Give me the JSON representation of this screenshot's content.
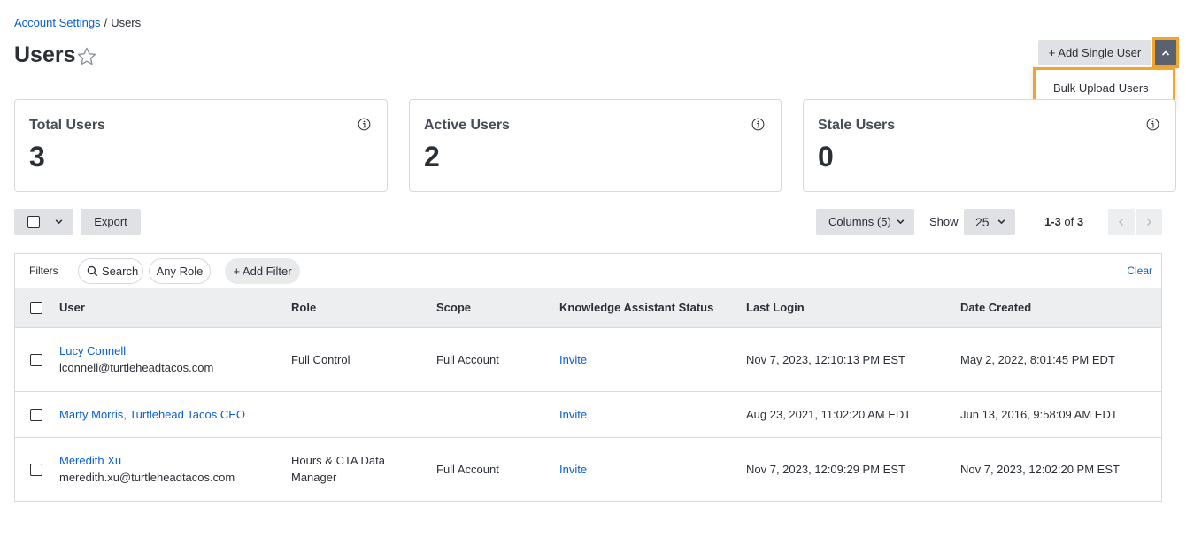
{
  "breadcrumb": {
    "parent": "Account Settings",
    "separator": "/",
    "current": "Users"
  },
  "header": {
    "title": "Users",
    "add_button": "+ Add Single User",
    "dropdown_item": "Bulk Upload Users"
  },
  "stats": [
    {
      "label": "Total Users",
      "value": "3"
    },
    {
      "label": "Active Users",
      "value": "2"
    },
    {
      "label": "Stale Users",
      "value": "0"
    }
  ],
  "toolbar": {
    "export": "Export",
    "columns": "Columns (5)",
    "show_label": "Show",
    "page_size": "25",
    "range": "1-3",
    "of_text": "of",
    "total": "3"
  },
  "filters": {
    "label": "Filters",
    "search": "Search",
    "role": "Any Role",
    "add": "+ Add Filter",
    "clear": "Clear"
  },
  "table": {
    "headers": [
      "User",
      "Role",
      "Scope",
      "Knowledge Assistant Status",
      "Last Login",
      "Date Created"
    ],
    "rows": [
      {
        "name": "Lucy Connell",
        "email": "lconnell@turtleheadtacos.com",
        "role": "Full Control",
        "scope": "Full Account",
        "status": "Invite",
        "last_login": "Nov 7, 2023, 12:10:13 PM EST",
        "created": "May 2, 2022, 8:01:45 PM EDT"
      },
      {
        "name": "Marty Morris, Turtlehead Tacos CEO",
        "email": "",
        "role": "",
        "scope": "",
        "status": "Invite",
        "last_login": "Aug 23, 2021, 11:02:20 AM EDT",
        "created": "Jun 13, 2016, 9:58:09 AM EDT"
      },
      {
        "name": "Meredith Xu",
        "email": "meredith.xu@turtleheadtacos.com",
        "role": "Hours & CTA Data Manager",
        "scope": "Full Account",
        "status": "Invite",
        "last_login": "Nov 7, 2023, 12:09:29 PM EST",
        "created": "Nov 7, 2023, 12:02:20 PM EST"
      }
    ]
  },
  "colors": {
    "link": "#0a5fd0",
    "highlight": "#f2a42b",
    "button_bg": "#dfe1e4",
    "dropdown_toggle": "#5a6270"
  }
}
